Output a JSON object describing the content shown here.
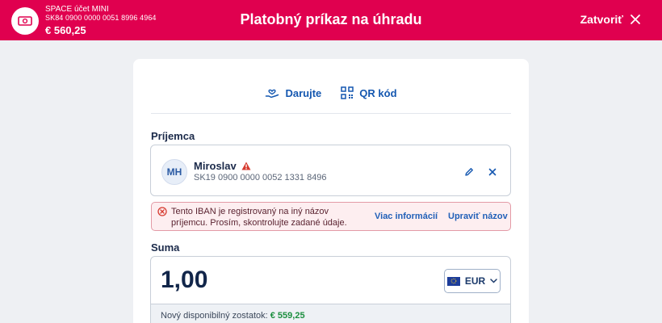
{
  "header": {
    "account_name": "SPACE účet MINI",
    "account_iban": "SK84 0900 0000 0051 8996 4964",
    "account_balance": "€ 560,25",
    "title": "Platobný príkaz na úhradu",
    "close_label": "Zatvoriť"
  },
  "links": {
    "donate_label": "Darujte",
    "qr_label": "QR kód"
  },
  "recipient": {
    "section_label": "Príjemca",
    "initials": "MH",
    "name": "Miroslav",
    "iban": "SK19 0900 0000 0052 1331 8496"
  },
  "error": {
    "message": "Tento IBAN je registrovaný na iný názov príjemcu. Prosím, skontrolujte zadané údaje.",
    "more_info_label": "Viac informácií",
    "edit_name_label": "Upraviť názov"
  },
  "amount": {
    "section_label": "Suma",
    "value": "1,00",
    "currency": "EUR",
    "available_label": "Nový disponibilný zostatok:",
    "available_value": "€ 559,25"
  },
  "colors": {
    "brand": "#e0004f",
    "link": "#1457b0",
    "error_bg": "#fdeef0",
    "highlight": "#5cc2ea",
    "positive": "#1c8f3f"
  }
}
